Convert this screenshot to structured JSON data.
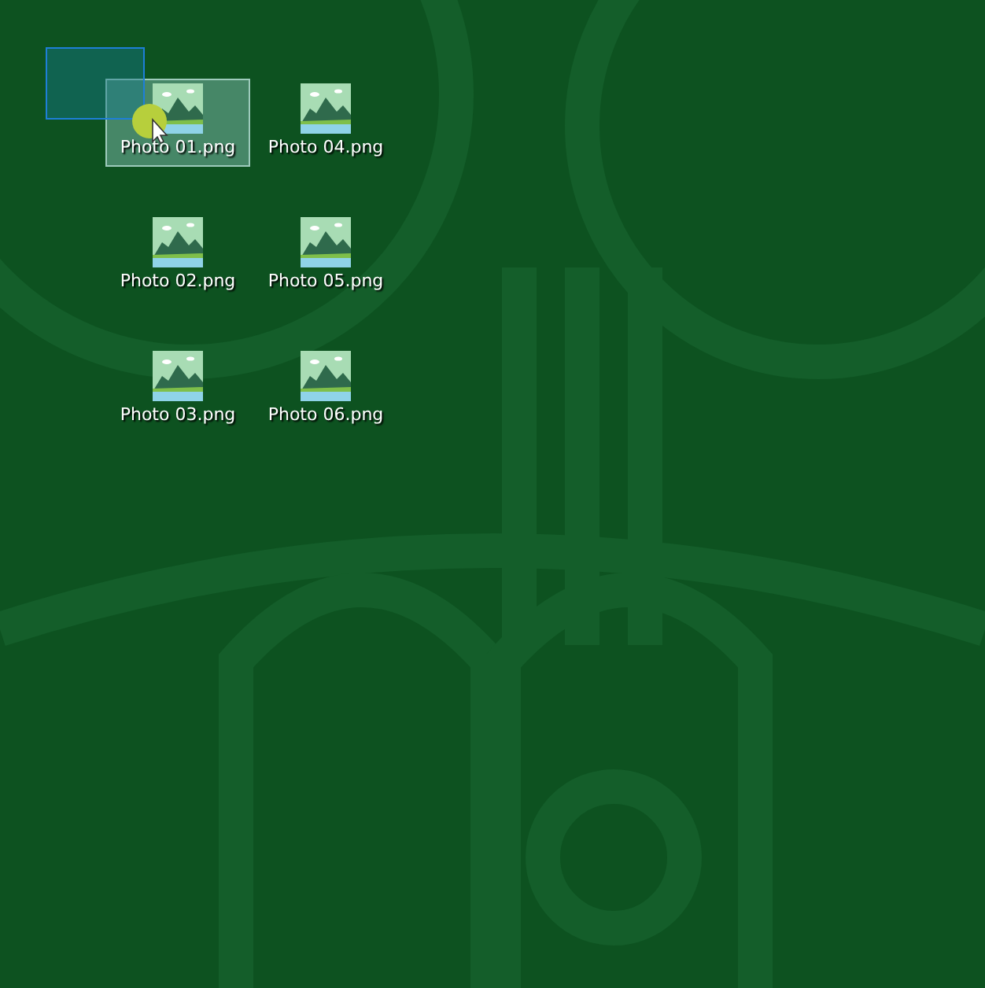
{
  "desktop": {
    "icons": [
      {
        "label": "Photo 01.png",
        "selected": true
      },
      {
        "label": "Photo 02.png",
        "selected": false
      },
      {
        "label": "Photo 03.png",
        "selected": false
      },
      {
        "label": "Photo 04.png",
        "selected": false
      },
      {
        "label": "Photo 05.png",
        "selected": false
      },
      {
        "label": "Photo 06.png",
        "selected": false
      }
    ]
  }
}
